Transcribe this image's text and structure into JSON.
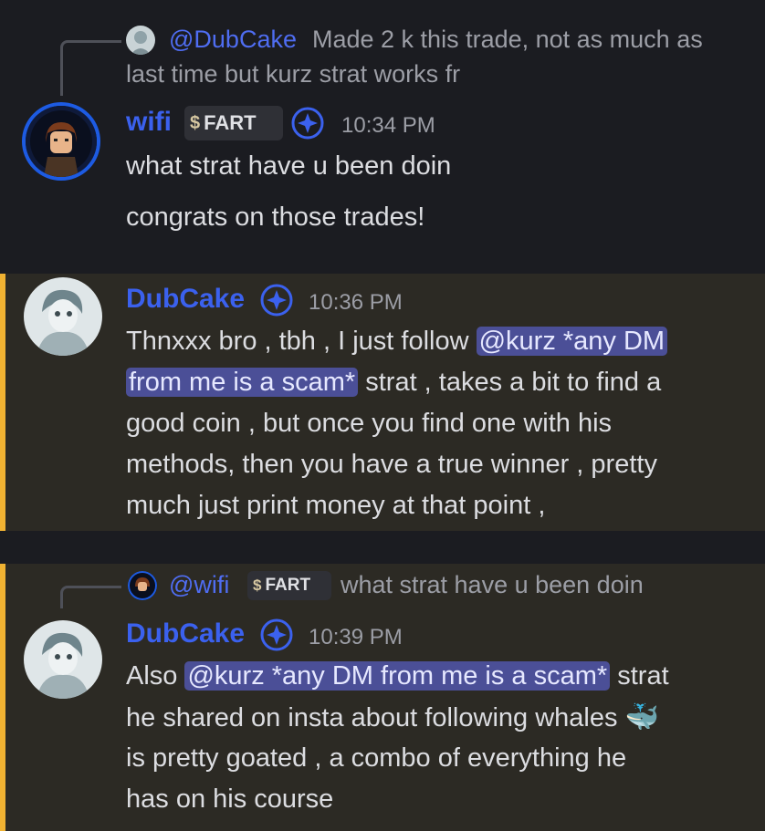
{
  "messages": [
    {
      "reply": {
        "author": "@DubCake",
        "text_line1": "Made 2 k this trade, not as much as",
        "text_line2": "last time but kurz strat works fr"
      },
      "author": "wifi",
      "tag": "FART",
      "time": "10:34 PM",
      "lines": [
        "what strat have u been doin",
        "congrats on those trades!"
      ]
    },
    {
      "author": "DubCake",
      "time": "10:36 PM",
      "line1_pre": "Thnxxx bro , tbh , I just follow ",
      "mention_part1": "@kurz *any DM",
      "mention_part2": "from me is a scam*",
      "line2_post": " strat , takes a bit to find a",
      "line3": "good coin , but once you find one with his",
      "line4": "methods, then you have a true winner , pretty",
      "line5": "much just print money at that point ,"
    },
    {
      "reply": {
        "author": "@wifi",
        "tag": "FART",
        "text": "what strat have u been doin"
      },
      "author": "DubCake",
      "time": "10:39 PM",
      "line1_pre": "Also ",
      "mention": "@kurz *any DM from me is a scam*",
      "line1_post": " strat",
      "line2": "he shared on insta about following whales",
      "whale_emoji": "🐳",
      "line3": "is pretty goated , a combo of everything he",
      "line4": "has on his course"
    }
  ],
  "colors": {
    "mention_highlight": "#f0b232",
    "username": "#3b61ee",
    "mention_bg": "#4b4f97"
  }
}
